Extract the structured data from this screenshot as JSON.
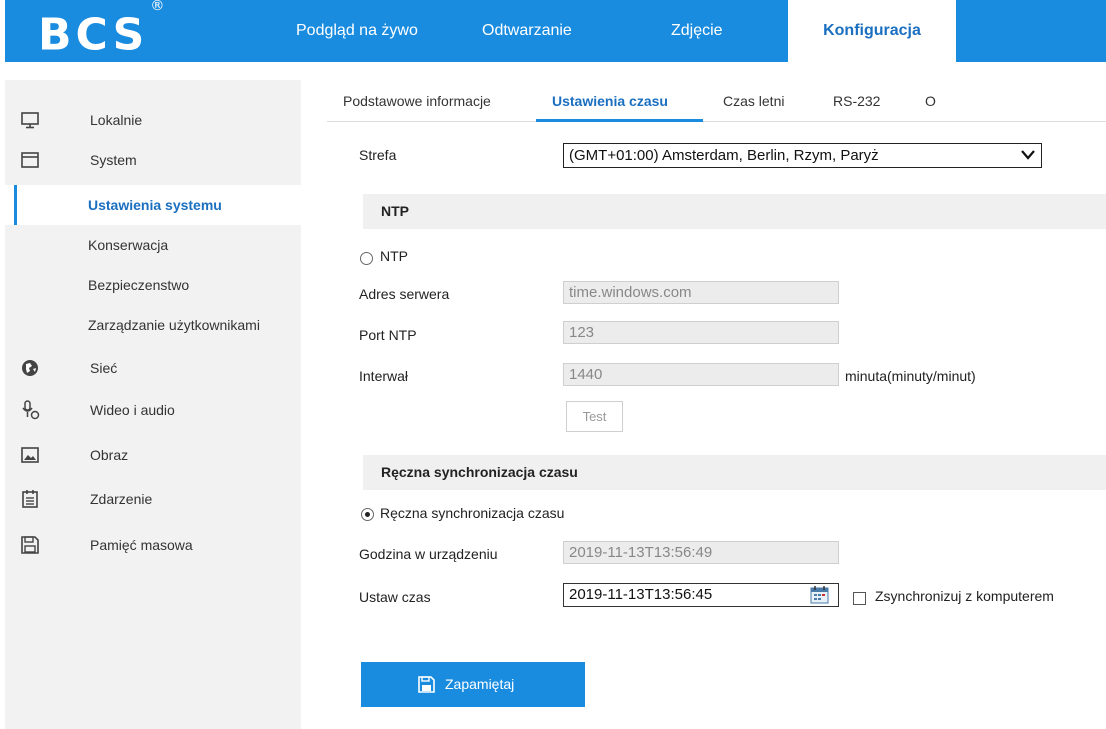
{
  "brand": {
    "logo": "BCS",
    "registered": "®"
  },
  "nav": {
    "items": [
      {
        "label": "Podgląd na żywo"
      },
      {
        "label": "Odtwarzanie"
      },
      {
        "label": "Zdjęcie"
      },
      {
        "label": "Konfiguracja",
        "active": true
      }
    ]
  },
  "sidebar": {
    "items": [
      {
        "label": "Lokalnie",
        "icon": "monitor-icon"
      },
      {
        "label": "System",
        "icon": "window-icon"
      },
      {
        "label": "Ustawienia systemu",
        "active": true
      },
      {
        "label": "Konserwacja"
      },
      {
        "label": "Bezpieczenstwo"
      },
      {
        "label": "Zarządzanie użytkownikami"
      },
      {
        "label": "Sieć",
        "icon": "globe-icon"
      },
      {
        "label": "Wideo i audio",
        "icon": "microphone-video-icon"
      },
      {
        "label": "Obraz",
        "icon": "image-icon"
      },
      {
        "label": "Zdarzenie",
        "icon": "calendar-list-icon"
      },
      {
        "label": "Pamięć masowa",
        "icon": "floppy-disk-icon"
      }
    ]
  },
  "tabs": [
    {
      "label": "Podstawowe informacje"
    },
    {
      "label": "Ustawienia czasu",
      "active": true
    },
    {
      "label": "Czas letni"
    },
    {
      "label": "RS-232"
    },
    {
      "label": "O"
    }
  ],
  "form": {
    "timezone_label": "Strefa",
    "timezone_value": "(GMT+01:00) Amsterdam, Berlin, Rzym, Paryż",
    "ntp_section": "NTP",
    "ntp_radio_label": "NTP",
    "ntp_selected": false,
    "server_label": "Adres serwera",
    "server_value": "time.windows.com",
    "port_label": "Port NTP",
    "port_value": "123",
    "interval_label": "Interwał",
    "interval_value": "1440",
    "interval_unit": "minuta(minuty/minut)",
    "test_button": "Test",
    "manual_section": "Ręczna synchronizacja czasu",
    "manual_radio_label": "Ręczna synchronizacja czasu",
    "manual_selected": true,
    "device_time_label": "Godzina w urządzeniu",
    "device_time_value": "2019-11-13T13:56:49",
    "set_time_label": "Ustaw czas",
    "set_time_value": "2019-11-13T13:56:45",
    "sync_pc_label": "Zsynchronizuj z komputerem",
    "sync_pc_checked": false,
    "save_button": "Zapamiętaj"
  },
  "colors": {
    "accent": "#1a8ce0",
    "active_text": "#1a6fc0",
    "sidebar_bg": "#f2f2f2",
    "section_bg": "#f0f0f0"
  }
}
